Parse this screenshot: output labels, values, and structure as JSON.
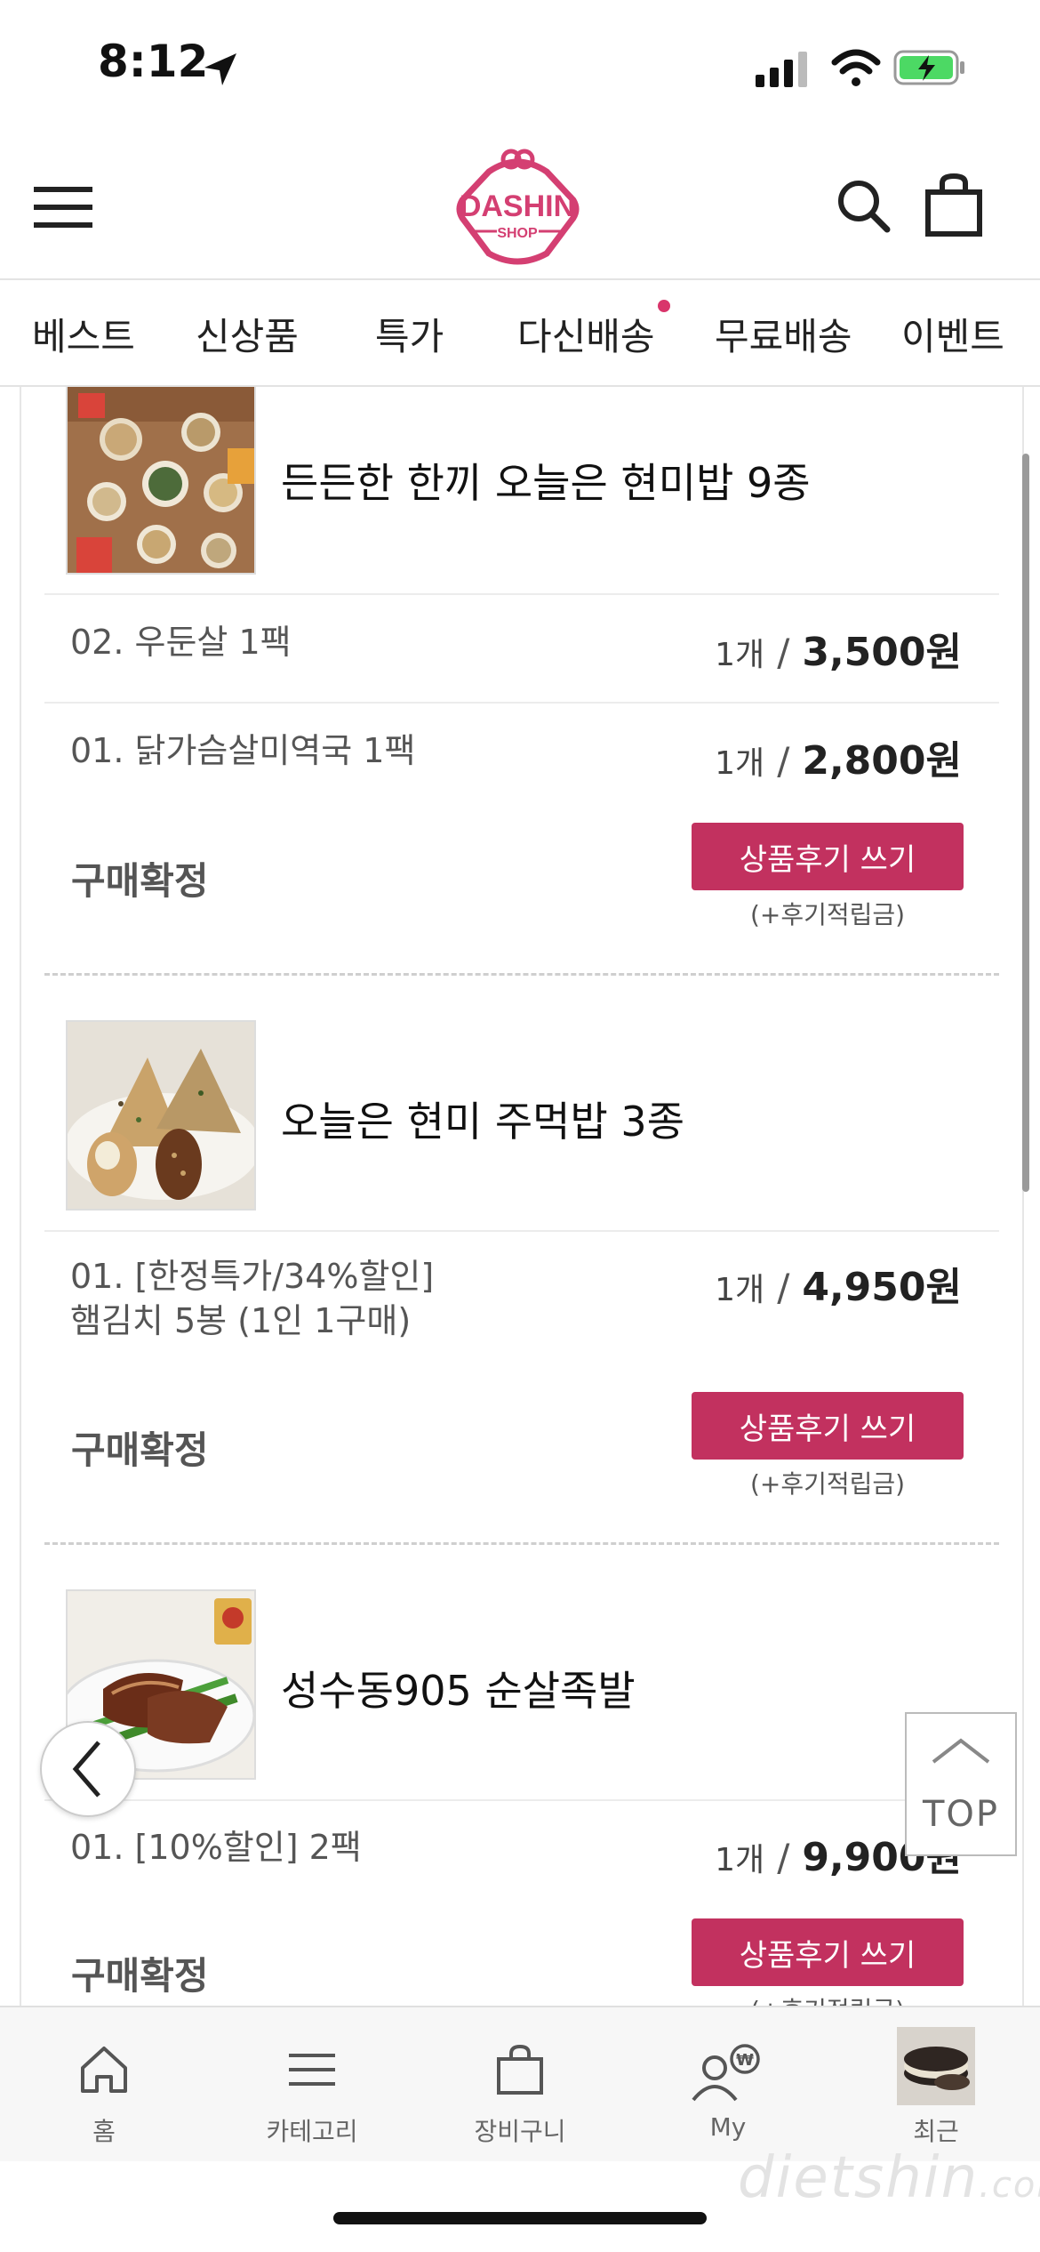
{
  "status_bar": {
    "time": "8:12"
  },
  "header": {
    "logo_top": "DASHIN",
    "logo_bottom": "SHOP"
  },
  "tabs": [
    {
      "label": "베스트"
    },
    {
      "label": "신상품"
    },
    {
      "label": "특가"
    },
    {
      "label": "다신배송",
      "has_dot": true
    },
    {
      "label": "무료배송"
    },
    {
      "label": "이벤트"
    }
  ],
  "orders": [
    {
      "title": "든든한 한끼 오늘은 현미밥 9종",
      "options": [
        {
          "name": "02. 우둔살 1팩",
          "qty": "1개",
          "price": "3,500원"
        },
        {
          "name": "01. 닭가슴살미역국 1팩",
          "qty": "1개",
          "price": "2,800원"
        }
      ],
      "status": "구매확정",
      "review_button": "상품후기 쓰기",
      "review_note": "(+후기적립금)"
    },
    {
      "title": "오늘은 현미 주먹밥 3종",
      "options": [
        {
          "name": "01. [한정특가/34%할인]",
          "name2": "햄김치 5봉 (1인 1구매)",
          "qty": "1개",
          "price": "4,950원"
        }
      ],
      "status": "구매확정",
      "review_button": "상품후기 쓰기",
      "review_note": "(+후기적립금)"
    },
    {
      "title": "성수동905 순살족발",
      "options": [
        {
          "name": "01. [10%할인] 2팩",
          "qty": "1개",
          "price": "9,900원"
        }
      ],
      "status": "구매확정",
      "review_button": "상품후기 쓰기",
      "review_note": "(+후기적립금)"
    }
  ],
  "price_separator": "/",
  "floating": {
    "top_label": "TOP"
  },
  "bottom_nav": [
    {
      "label": "홈",
      "icon": "home-icon"
    },
    {
      "label": "카테고리",
      "icon": "menu-icon"
    },
    {
      "label": "장비구니",
      "icon": "bag-icon"
    },
    {
      "label": "My",
      "icon": "user-won-icon"
    },
    {
      "label": "최근",
      "icon": "recent-product-thumbnail"
    }
  ],
  "watermark": {
    "text": "dietshin",
    "suffix": ".com"
  },
  "colors": {
    "accent": "#c2315f",
    "brand": "#d43f72",
    "dot": "#d9356b"
  }
}
